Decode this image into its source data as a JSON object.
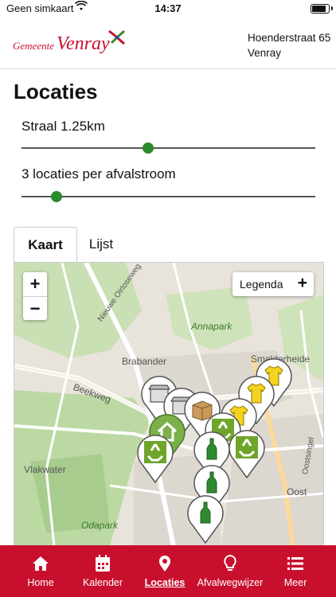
{
  "status": {
    "carrier": "Geen simkaart",
    "time": "14:37"
  },
  "header": {
    "logo_text_1": "Gemeente",
    "logo_text_2": "Venray",
    "address_line1": "Hoenderstraat 65",
    "address_line2": "Venray"
  },
  "page": {
    "title": "Locaties"
  },
  "radius": {
    "label": "Straal 1.25km",
    "value_fraction": 0.43
  },
  "count": {
    "label": "3 locaties per afvalstroom",
    "value_fraction": 0.12
  },
  "tabs": [
    {
      "label": "Kaart",
      "active": true
    },
    {
      "label": "Lijst",
      "active": false
    }
  ],
  "map": {
    "zoom_in": "+",
    "zoom_out": "−",
    "legend_label": "Legenda",
    "legend_plus": "+",
    "places": [
      "Brabander",
      "Beekweg",
      "Annapark",
      "Smakterheide",
      "Vlakwater",
      "Odapark",
      "Oost",
      "Oostsingel",
      "Nieuwe Oirloseweg"
    ]
  },
  "colors": {
    "brand": "#c8102e",
    "slider": "#2b8a2b",
    "recycle": "#6fa52a",
    "textile": "#f4d31f"
  },
  "nav": [
    {
      "label": "Home",
      "icon": "home-icon"
    },
    {
      "label": "Kalender",
      "icon": "calendar-icon"
    },
    {
      "label": "Locaties",
      "icon": "location-pin-icon",
      "active": true
    },
    {
      "label": "Afvalwegwijzer",
      "icon": "lightbulb-icon"
    },
    {
      "label": "Meer",
      "icon": "menu-icon"
    }
  ]
}
